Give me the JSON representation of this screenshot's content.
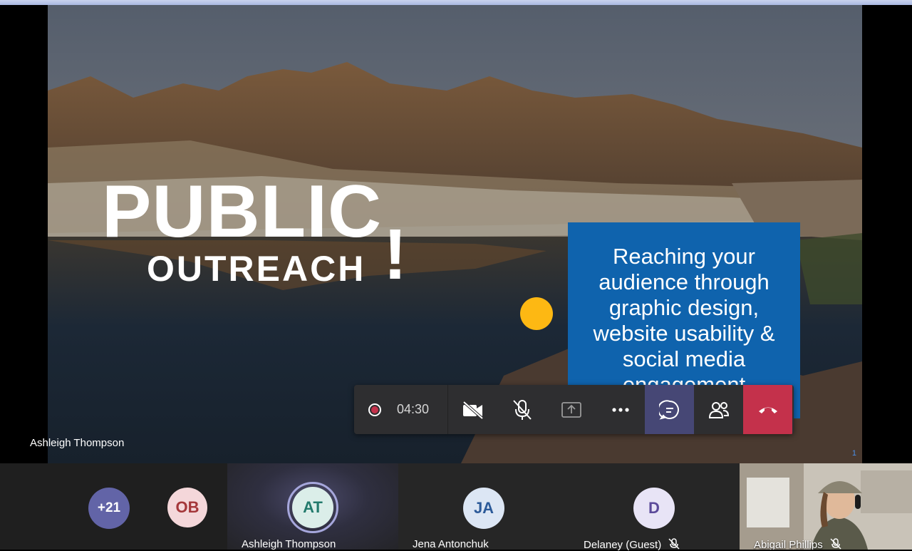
{
  "slide": {
    "title_line1": "PUBLIC",
    "title_line2": "OUTREACH",
    "title_mark": "!",
    "box_text_lines": [
      "Reaching your",
      "audience through",
      "graphic design,",
      "website usability &",
      "social media",
      "engagement"
    ],
    "page_number": "1",
    "colors": {
      "box": "#0f63ad",
      "dot": "#fdb813"
    }
  },
  "presenter": {
    "name": "Ashleigh Thompson"
  },
  "toolbar": {
    "record_icon": "record-icon",
    "elapsed": "04:30",
    "buttons": [
      {
        "icon": "camera-off-icon"
      },
      {
        "icon": "mic-off-icon"
      },
      {
        "icon": "share-screen-icon"
      },
      {
        "icon": "more-options-icon"
      },
      {
        "icon": "chat-icon"
      },
      {
        "icon": "participants-icon"
      },
      {
        "icon": "hang-up-icon"
      }
    ],
    "colors": {
      "hangup": "#c4314b",
      "chat_active": "#464775"
    }
  },
  "participants": [
    {
      "initials": "+21",
      "name": ""
    },
    {
      "initials": "OB",
      "name": ""
    },
    {
      "initials": "AT",
      "name": "Ashleigh Thompson",
      "speaking": true
    },
    {
      "initials": "JA",
      "name": "Jena Antonchuk"
    },
    {
      "initials": "D",
      "name": "Delaney (Guest)",
      "muted": true
    },
    {
      "initials": "",
      "name": "Abigail Phillips",
      "muted": true,
      "video": true
    }
  ]
}
